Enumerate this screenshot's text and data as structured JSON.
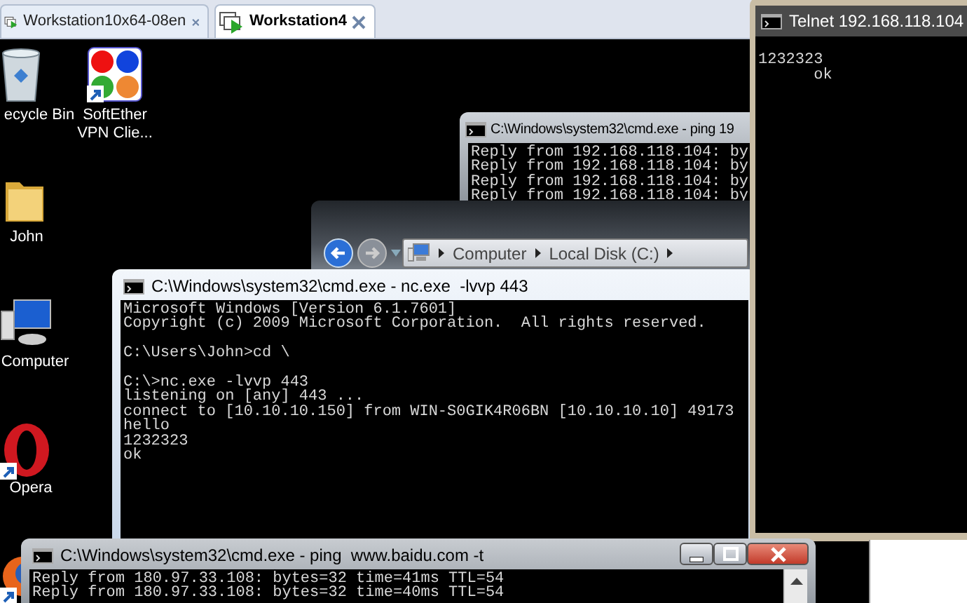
{
  "vm_tabs": [
    {
      "label": "Workstation10x64-08en",
      "selected": false
    },
    {
      "label": "Workstation4",
      "selected": true
    }
  ],
  "desktop_icons": [
    {
      "kind": "recycle_bin",
      "label_lines": [
        "ecycle Bin"
      ],
      "shortcut": false
    },
    {
      "kind": "softether",
      "label_lines": [
        "SoftEther",
        "VPN Clie..."
      ],
      "shortcut": true
    },
    {
      "kind": "folder",
      "label_lines": [
        "John"
      ],
      "shortcut": false
    },
    {
      "kind": "computer",
      "label_lines": [
        "Computer"
      ],
      "shortcut": false
    },
    {
      "kind": "opera",
      "label_lines": [
        "Opera"
      ],
      "shortcut": true
    },
    {
      "kind": "firefox",
      "shortcut": true
    }
  ],
  "windows": [
    {
      "kind": "cmd",
      "title": "C:\\Windows\\system32\\cmd.exe - ping 19",
      "output": "Reply from 192.168.118.104: by\nReply from 192.168.118.104: by\nReply from 192.168.118.104: by\nReply from 192.168.118.104: by"
    },
    {
      "kind": "explorer",
      "breadcrumb": [
        "Computer",
        "Local Disk (C:)"
      ]
    },
    {
      "kind": "cmd",
      "title": "C:\\Windows\\system32\\cmd.exe - nc.exe  -lvvp 443",
      "output": "Microsoft Windows [Version 6.1.7601]\nCopyright (c) 2009 Microsoft Corporation.  All rights reserved.\n\nC:\\Users\\John>cd \\\n\nC:\\>nc.exe -lvvp 443\nlistening on [any] 443 ...\nconnect to [10.10.10.150] from WIN-S0GIK4R06BN [10.10.10.10] 49173\nhello\n1232323\nok"
    },
    {
      "kind": "telnet",
      "title": "Telnet 192.168.118.104",
      "output": "\n1232323\n      ok"
    },
    {
      "kind": "cmd",
      "title": "C:\\Windows\\system32\\cmd.exe - ping  www.baidu.com -t",
      "output": "Reply from 180.97.33.108: bytes=32 time=41ms TTL=54\nReply from 180.97.33.108: bytes=32 time=40ms TTL=54",
      "caption_buttons": true
    }
  ]
}
